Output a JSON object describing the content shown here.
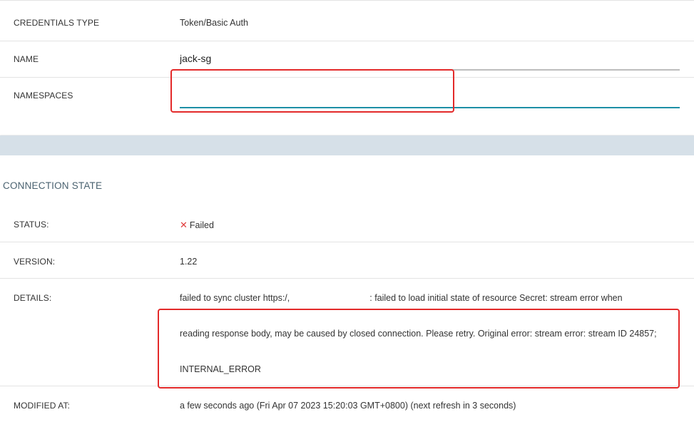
{
  "credentials": {
    "type_label": "CREDENTIALS TYPE",
    "type_value": "Token/Basic Auth",
    "name_label": "NAME",
    "name_value": "jack-sg",
    "namespaces_label": "NAMESPACES",
    "namespaces_value": ""
  },
  "connection_state": {
    "title": "CONNECTION STATE",
    "status_label": "STATUS:",
    "status_value": "Failed",
    "version_label": "VERSION:",
    "version_value": "1.22",
    "details_label": "DETAILS:",
    "details_line1_prefix": "failed to sync cluster https:/,",
    "details_line1_suffix": ": failed to load initial state of resource Secret: stream error when",
    "details_line2": "reading response body, may be caused by closed connection. Please retry. Original error: stream error: stream ID 24857;",
    "details_line3": "INTERNAL_ERROR",
    "modified_label": "MODIFIED AT:",
    "modified_value": "a few seconds ago (Fri Apr 07 2023 15:20:03 GMT+0800) (next refresh in 3 seconds)"
  },
  "icons": {
    "status": "close-x-icon"
  },
  "colors": {
    "highlight": "#e32a2a",
    "focus_underline": "#1d8fa6",
    "failed": "#e03a3a",
    "band": "#d6e0e8"
  }
}
